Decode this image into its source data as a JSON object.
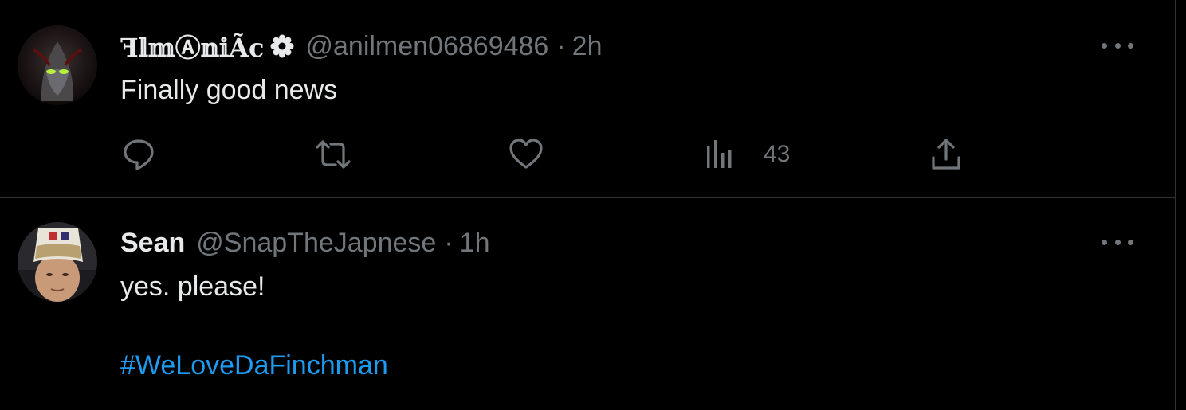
{
  "tweets": [
    {
      "display_name": "ꟻ𝕝𝕞Ⓐ𝕟𝕚Ãc",
      "handle": "@anilmen06869486",
      "separator": "·",
      "time": "2h",
      "text": "Finally good news",
      "verified_badge": "verified-badge-icon",
      "actions": {
        "reply": "reply-icon",
        "retweet": "retweet-icon",
        "like": "like-icon",
        "views": "views-icon",
        "views_count": "43",
        "share": "share-icon"
      }
    },
    {
      "display_name": "Sean",
      "handle": "@SnapTheJapnese",
      "separator": "·",
      "time": "1h",
      "text": "yes. please!",
      "hashtag": "#WeLoveDaFinchman"
    }
  ],
  "colors": {
    "background": "#000000",
    "text_primary": "#e7e9ea",
    "text_secondary": "#71767b",
    "link": "#1d9bf0",
    "divider": "#2f3336"
  }
}
